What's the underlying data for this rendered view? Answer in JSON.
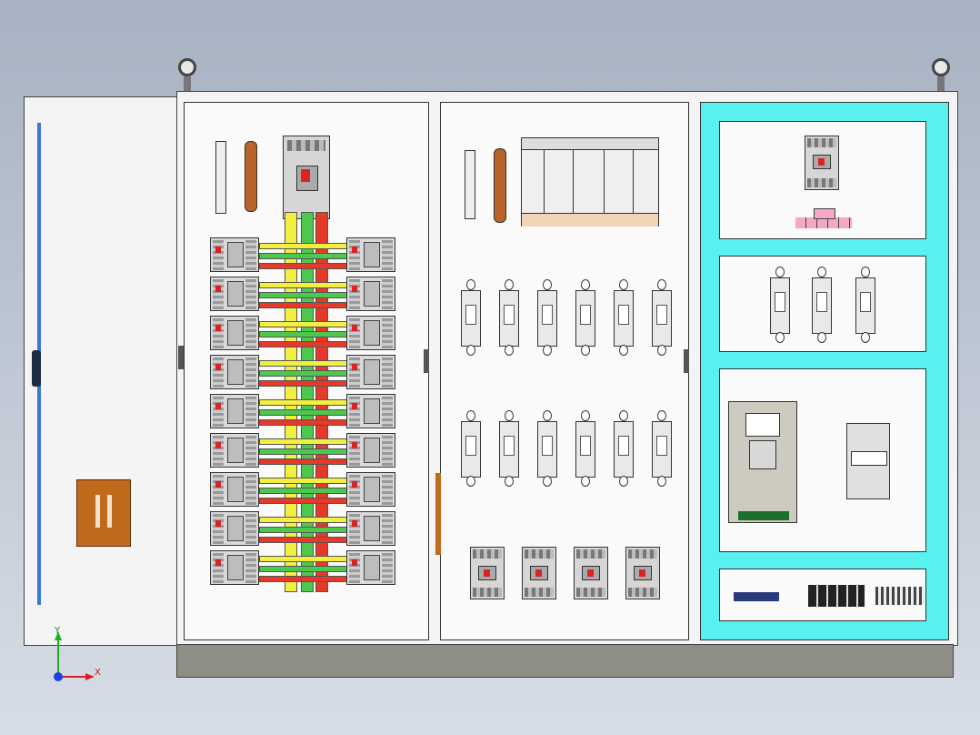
{
  "axis_triad": {
    "x_label": "X",
    "y_label": "Y",
    "x_color": "#e02020",
    "y_color": "#20b020",
    "z_color": "#2040e0"
  },
  "colors": {
    "cabinet": "#f4f4f4",
    "plinth": "#8e8e86",
    "busbar_red": "#e53a2a",
    "busbar_green": "#4cc84c",
    "busbar_yellow": "#f3ef40",
    "copper": "#b8642a",
    "cyan_frame": "#59f0f0",
    "door_strip": "#3a78d8",
    "door_handle": "#c06a1c"
  },
  "icons": {
    "lifting_eye": "lifting-eye-icon",
    "axis": "axis-triad-icon"
  }
}
